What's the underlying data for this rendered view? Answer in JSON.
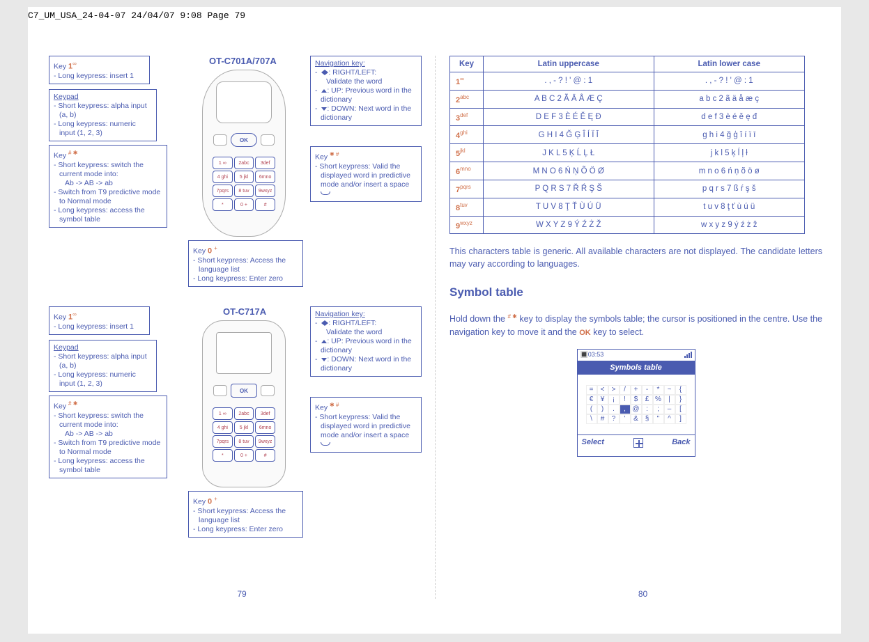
{
  "header_line": "C7_UM_USA_24-04-07  24/04/07  9:08  Page 79",
  "left": {
    "phone1_title": "OT-C701A/707A",
    "phone2_title": "OT-C717A",
    "key1_title": "Key",
    "key1_num": "1",
    "key1_sup": "∞",
    "key1_l1": "-  Long keypress: insert 1",
    "keypad_title": "Keypad",
    "keypad_l1": "-  Short keypress: alpha input (a, b)",
    "keypad_l2": "-  Long keypress: numeric input (1, 2, 3)",
    "keyhash_title": "Key",
    "keyhash_sup": "# ✱",
    "keyhash_l1": "-  Short keypress: switch the current mode into:",
    "keyhash_l1b": "Ab -> AB -> ab",
    "keyhash_l2": "-  Switch from T9 predictive mode to Normal mode",
    "keyhash_l3": "-  Long keypress: access the symbol table",
    "key0_title": "Key",
    "key0_num": "0",
    "key0_sup": "+",
    "key0_l1": "-  Short keypress: Access the language list",
    "key0_l2": "-  Long keypress: Enter zero",
    "nav_title": "Navigation key:",
    "nav_l1a": ": RIGHT/LEFT:",
    "nav_l1b": "Validate the word",
    "nav_l2": ": UP: Previous word in the dictionary",
    "nav_l3": ": DOWN: Next word in the dictionary",
    "keystar_title": "Key",
    "keystar_sup": "✱ #",
    "keystar_l1": "-  Short keypress: Valid the displayed word in predictive mode and/or insert a space",
    "keys": [
      "1 ∞",
      "2abc",
      "3def",
      "4 ghi",
      "5 jkl",
      "6mno",
      "7pqrs",
      "8 tuv",
      "9wxyz",
      "*",
      "0 +",
      "#"
    ],
    "page_num": "79"
  },
  "right": {
    "table": {
      "headers": [
        "Key",
        "Latin uppercase",
        "Latin lower case"
      ],
      "rows": [
        {
          "k": "1",
          "ks": "∞",
          "u": ".  ,  -  ?  !  '  @  :  1",
          "l": ".  ,  -  ?  !  '  @  :  1"
        },
        {
          "k": "2",
          "ks": "abc",
          "u": "A B C 2 Ã Ä Å Æ Ç",
          "l": "a b c 2 ã ä å æ ç"
        },
        {
          "k": "3",
          "ks": "def",
          "u": "D E F 3 È É Ě Ę Đ",
          "l": "d e f 3 è é ě ę đ"
        },
        {
          "k": "4",
          "ks": "ghi",
          "u": "G H I 4 Ğ Ģ Î Í Ï Ī",
          "l": "g h i 4 ğ ģ î í ï ī"
        },
        {
          "k": "5",
          "ks": "jkl",
          "u": "J K L 5 Ķ Ĺ Ļ Ł",
          "l": "j k l 5 ķ ĺ ļ ł"
        },
        {
          "k": "6",
          "ks": "mno",
          "u": "M N O 6 Ń Ņ Õ Ö Ø",
          "l": "m n o 6 ń ņ õ ö ø"
        },
        {
          "k": "7",
          "ks": "pqrs",
          "u": "P Q R S 7 Ř Ŕ Ş Š",
          "l": "p q r s 7 ß ŕ ş š"
        },
        {
          "k": "8",
          "ks": "tuv",
          "u": "T U V 8 Ţ Ť Ù Ú Ü",
          "l": "t u v 8 ţ ť ù ú ü"
        },
        {
          "k": "9",
          "ks": "wxyz",
          "u": "W X Y Z 9 Ý Ź Ż Ž",
          "l": "w x y z 9 ý ź ż ž"
        }
      ]
    },
    "para1": "This characters table is generic. All available characters are not displayed. The candidate letters may vary according to languages.",
    "heading": "Symbol table",
    "para2a": "Hold down the ",
    "para2b": " key to display the symbols table; the cursor is positioned in the centre. Use the navigation key to move it and the ",
    "para2c": " key to select.",
    "ok_text": "OK",
    "hash_sup": "# ✱",
    "symbols": {
      "time": "03:53",
      "title": "Symbols table",
      "cells": [
        "=",
        "<",
        ">",
        "/",
        "+",
        "-",
        "*",
        "~",
        "{",
        "€",
        "¥",
        "¡",
        "!",
        "$",
        "£",
        "%",
        "|",
        "}",
        "(",
        ")",
        ".",
        ",",
        "@",
        ":",
        ";",
        "–",
        "[",
        "\\",
        "#",
        "?",
        "'",
        "&",
        "§",
        "\"",
        "^",
        "]"
      ],
      "selected_index": 21,
      "select_label": "Select",
      "back_label": "Back"
    },
    "page_num": "80"
  }
}
